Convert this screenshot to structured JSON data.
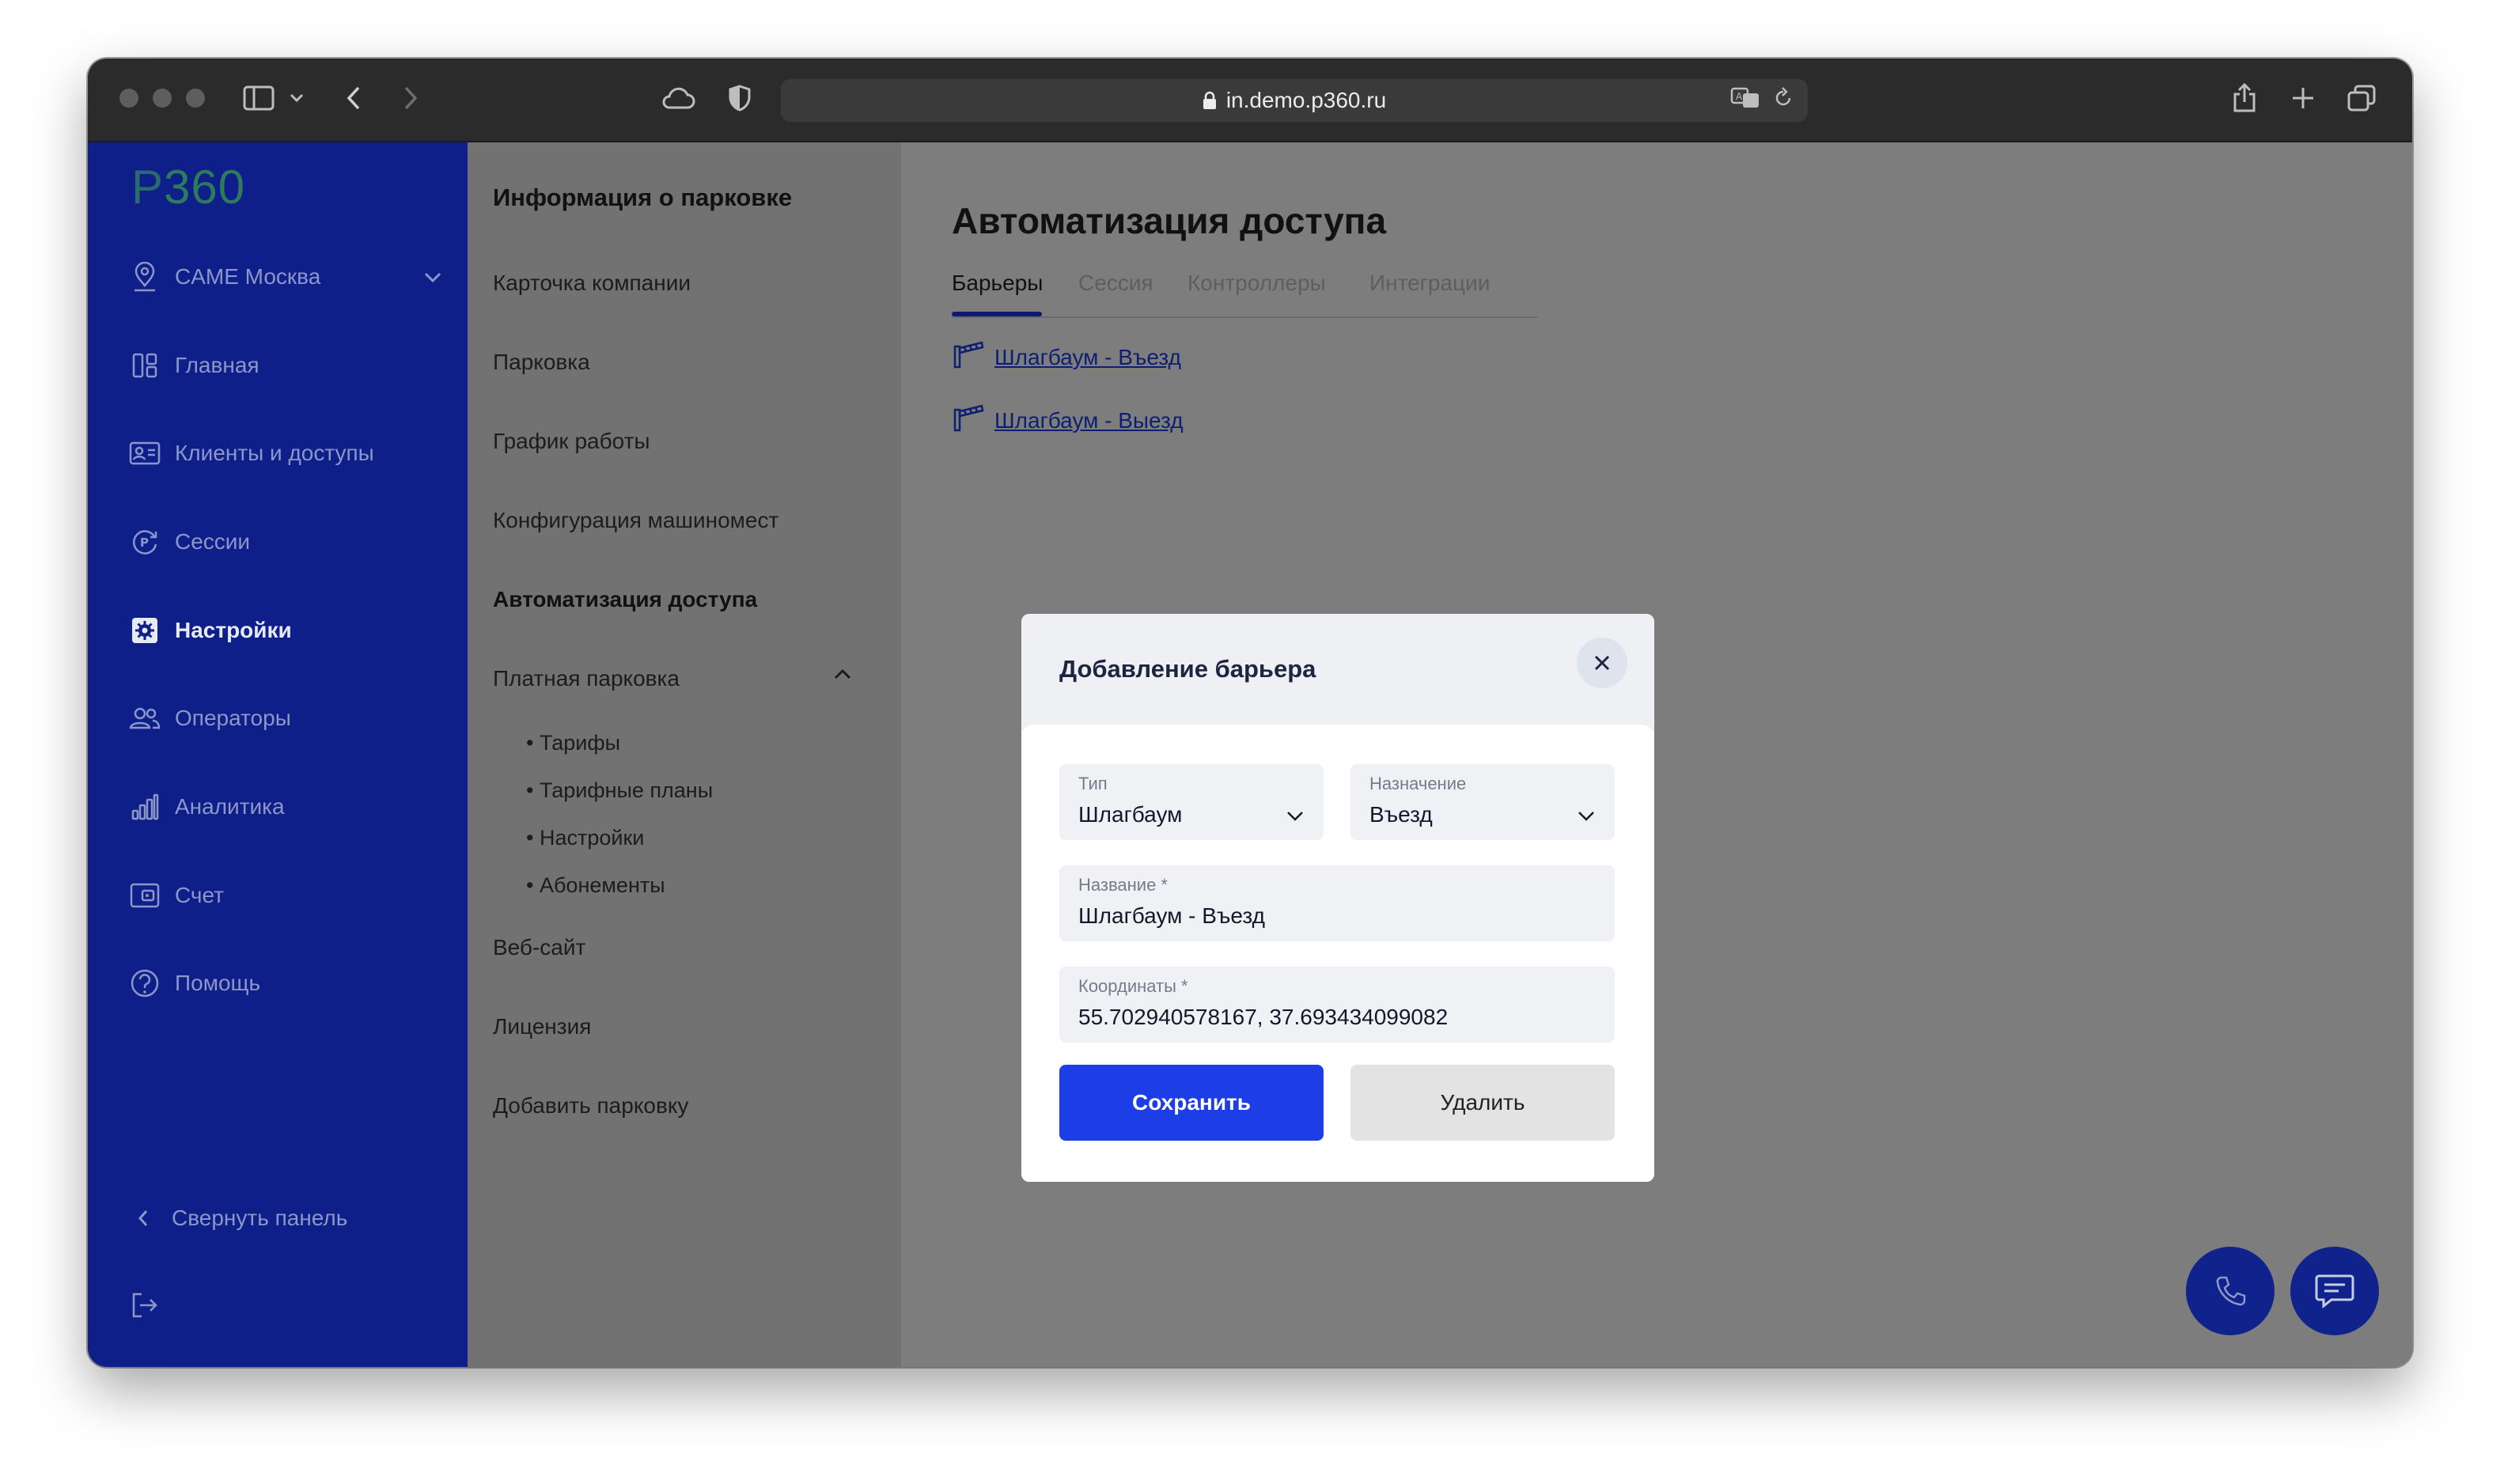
{
  "browser": {
    "url": "in.demo.p360.ru"
  },
  "sidebar": {
    "logo_letter": "P",
    "logo_number": "360",
    "location": "CAME Москва",
    "items": [
      {
        "label": "Главная"
      },
      {
        "label": "Клиенты и доступы"
      },
      {
        "label": "Сессии"
      },
      {
        "label": "Настройки"
      },
      {
        "label": "Операторы"
      },
      {
        "label": "Аналитика"
      },
      {
        "label": "Счет"
      },
      {
        "label": "Помощь"
      }
    ],
    "collapse_label": "Свернуть панель"
  },
  "subnav": {
    "title": "Информация о парковке",
    "items": [
      "Карточка компании",
      "Парковка",
      "График работы",
      "Конфигурация машиномест",
      "Автоматизация доступа",
      "Платная парковка"
    ],
    "paid_sub": [
      "• Тарифы",
      "• Тарифные планы",
      "• Настройки",
      "• Абонементы"
    ],
    "bottom": [
      "Веб-сайт",
      "Лицензия",
      "Добавить парковку"
    ]
  },
  "main": {
    "title": "Автоматизация доступа",
    "tabs": [
      "Барьеры",
      "Сессия",
      "Контроллеры",
      "Интеграции"
    ],
    "barriers": [
      "Шлагбаум - Въезд",
      "Шлагбаум - Выезд"
    ]
  },
  "modal": {
    "title": "Добавление барьера",
    "type_label": "Тип",
    "type_value": "Шлагбаум",
    "purpose_label": "Назначение",
    "purpose_value": "Въезд",
    "name_label": "Название *",
    "name_value": "Шлагбаум - Въезд",
    "coords_label": "Координаты *",
    "coords_value": "55.702940578167, 37.693434099082",
    "save_label": "Сохранить",
    "delete_label": "Удалить"
  },
  "colors": {
    "sidebar": "#0f1f8a",
    "primary_button": "#1d3ee6",
    "link": "#0c1f73"
  }
}
